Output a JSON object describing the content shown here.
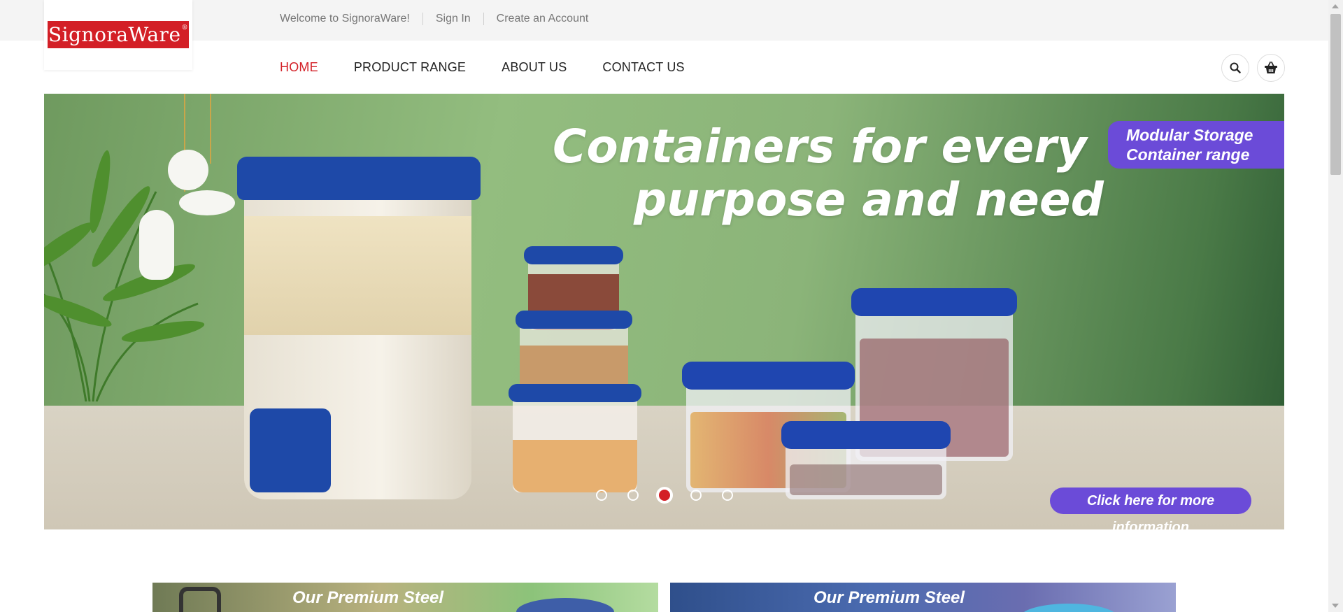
{
  "topbar": {
    "welcome": "Welcome to SignoraWare!",
    "sign_in": "Sign In",
    "create_account": "Create an Account"
  },
  "logo": {
    "text": "SignoraWare",
    "mark": "®"
  },
  "nav": {
    "items": [
      {
        "label": "HOME",
        "active": true
      },
      {
        "label": "PRODUCT RANGE",
        "active": false
      },
      {
        "label": "ABOUT US",
        "active": false
      },
      {
        "label": "CONTACT US",
        "active": false
      }
    ],
    "search_icon": "search-icon",
    "cart_icon": "basket-icon"
  },
  "hero": {
    "title_line1": "Containers for every",
    "title_line2": "purpose and need",
    "tag_line1": "Modular Storage",
    "tag_line2": "Container range",
    "cta": "Click here for more information",
    "slide_count": 5,
    "active_slide": 3
  },
  "banners": [
    {
      "text": "Our Premium Steel"
    },
    {
      "text": "Our Premium Steel"
    }
  ],
  "colors": {
    "brand_red": "#d31f26",
    "accent_purple": "#6b4bd8",
    "lid_blue": "#1e49a8"
  }
}
